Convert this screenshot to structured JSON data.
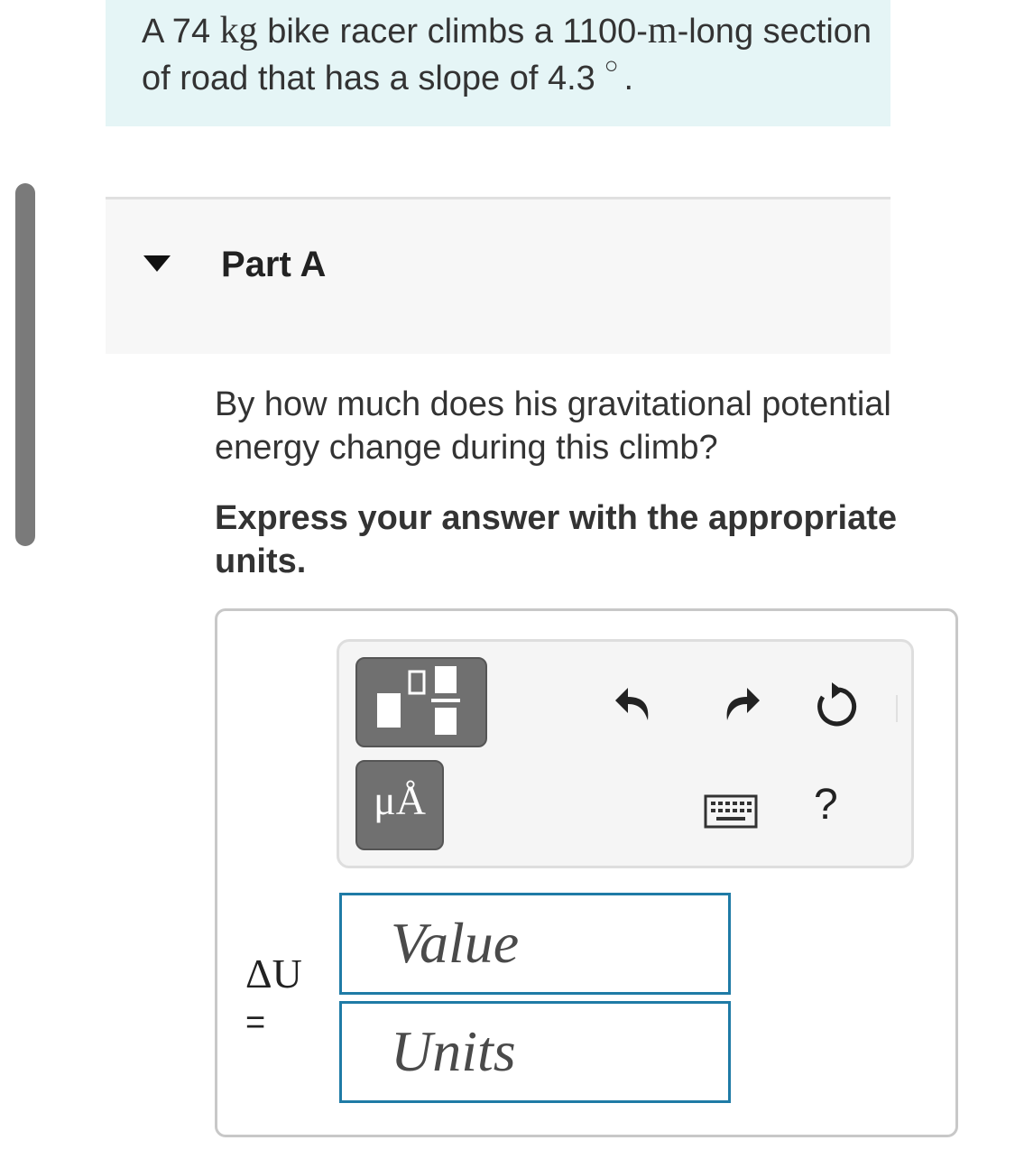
{
  "problem": {
    "prefix": "A 74",
    "mass_unit": "kg",
    "middle": "bike racer climbs a 1100-",
    "length_unit": "m",
    "suffix": "-long section of road that has a slope of 4.3",
    "degree_symbol": "○",
    "period": "."
  },
  "part": {
    "title": "Part A",
    "question": "By how much does his gravitational potential energy change during this climb?",
    "instruction": "Express your answer with the appropriate units."
  },
  "toolbar": {
    "units_button_label": "μÅ",
    "help_label": "?",
    "icons": [
      "templates-icon",
      "units-icon",
      "undo-icon",
      "redo-icon",
      "reset-icon",
      "keyboard-icon",
      "help-icon"
    ]
  },
  "answer": {
    "variable": "ΔU",
    "equals": "=",
    "value_placeholder": "Value",
    "units_placeholder": "Units"
  },
  "colors": {
    "problem_bg": "#e5f5f6",
    "field_border": "#1f7ba6",
    "button_bg": "#707070"
  }
}
